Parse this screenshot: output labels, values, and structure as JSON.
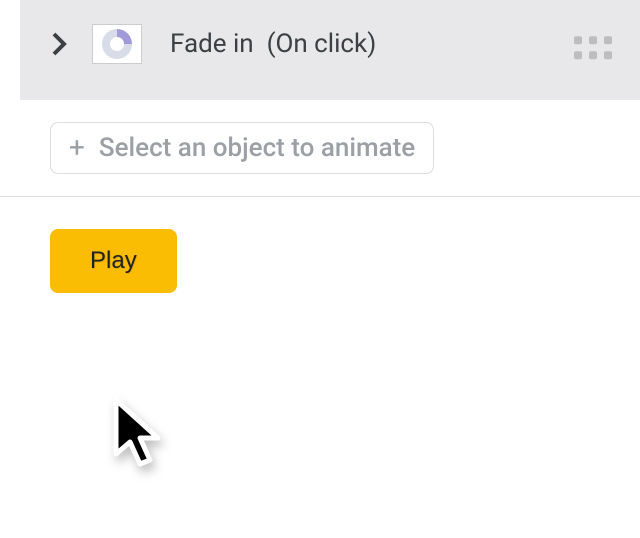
{
  "animation": {
    "effect_label": "Fade in",
    "trigger_label": "(On click)",
    "thumbnail_desc": "pie-chart-thumbnail"
  },
  "select_object": {
    "label": "Select an object to animate"
  },
  "play": {
    "label": "Play"
  },
  "colors": {
    "accent": "#fbbc04",
    "row_bg": "#e8e8ea",
    "muted_text": "#9aa0a6"
  }
}
